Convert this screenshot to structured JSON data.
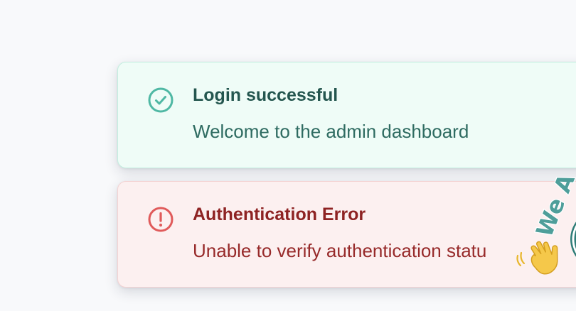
{
  "colors": {
    "page_background": "#f8f9fb",
    "success_background": "#effcf7",
    "success_accent": "#4fb8a4",
    "success_text": "#24564f",
    "error_background": "#fcf0f0",
    "error_accent": "#e05a5a",
    "error_text": "#8e2323"
  },
  "notifications": [
    {
      "type": "success",
      "icon": "check-circle-icon",
      "title": "Login successful",
      "message": "Welcome to the admin dashboard"
    },
    {
      "type": "error",
      "icon": "exclamation-circle-icon",
      "title": "Authentication Error",
      "message": "Unable to verify authentication statu"
    }
  ],
  "sticker": {
    "icon": "waving-hand-sticker-icon",
    "text": "We A"
  }
}
